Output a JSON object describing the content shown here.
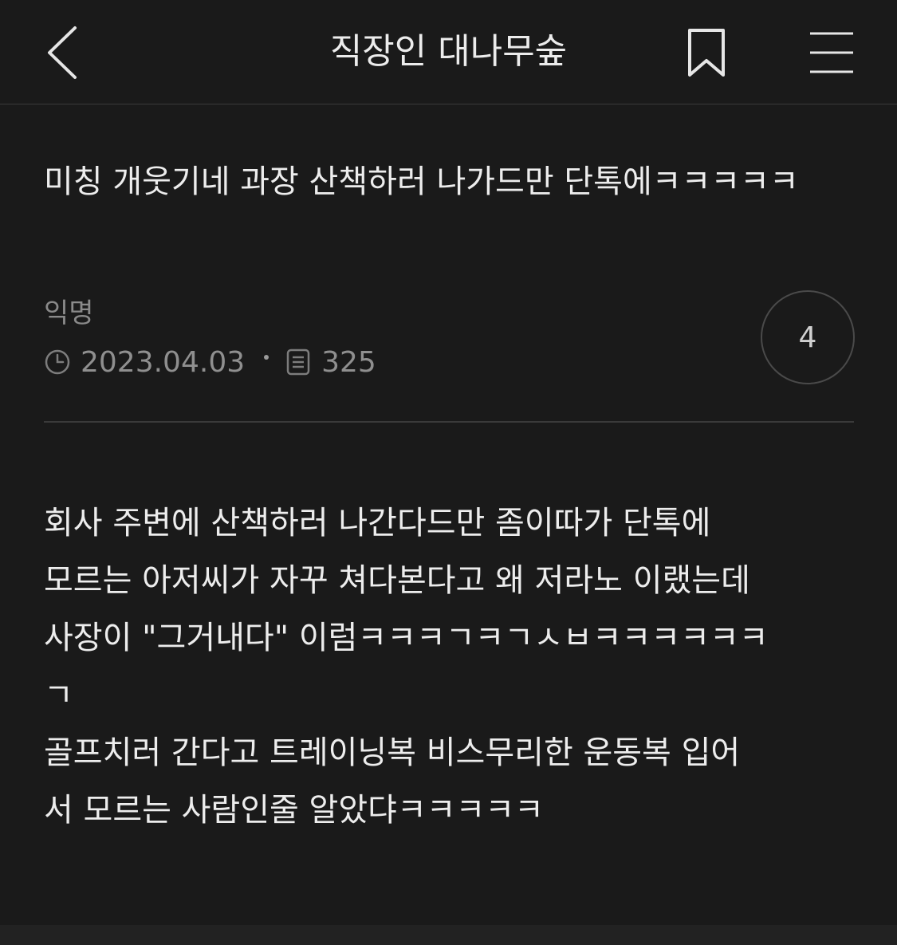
{
  "header": {
    "title": "직장인 대나무숲",
    "back_icon": "chevron-left-icon",
    "bookmark_icon": "bookmark-icon",
    "menu_icon": "hamburger-menu-icon"
  },
  "post": {
    "title": "미칭 개웃기네 과장 산책하러 나가드만 단톡에ㅋㅋㅋㅋㅋ",
    "author": "익명",
    "date": "2023.04.03",
    "views": "325",
    "comment_count": "4",
    "body_lines": [
      "회사 주변에 산책하러 나간다드만 좀이따가 단톡에",
      "모르는 아저씨가 자꾸 쳐다본다고 왜 저라노 이랬는데",
      "사장이 \"그거내다\" 이럼ㅋㅋㅋㄱㅋㄱㅅㅂㅋㅋㅋㅋㅋㅋ",
      "ㄱ",
      "골프치러 간다고 트레이닝복 비스무리한 운동복 입어",
      "서 모르는 사람인줄 알았댜ㅋㅋㅋㅋㅋ"
    ]
  },
  "colors": {
    "background": "#1a1a1a",
    "text": "#ededed",
    "muted": "#8f8f8f",
    "divider": "#3a3a3a"
  }
}
